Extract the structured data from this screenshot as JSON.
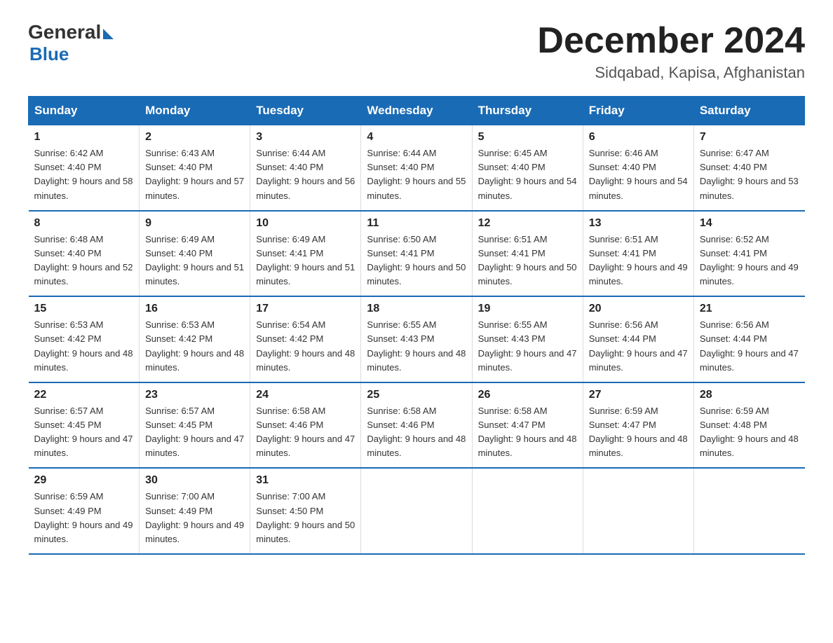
{
  "header": {
    "logo_general": "General",
    "logo_blue": "Blue",
    "month_year": "December 2024",
    "location": "Sidqabad, Kapisa, Afghanistan"
  },
  "weekdays": [
    "Sunday",
    "Monday",
    "Tuesday",
    "Wednesday",
    "Thursday",
    "Friday",
    "Saturday"
  ],
  "weeks": [
    [
      {
        "day": "1",
        "sunrise": "6:42 AM",
        "sunset": "4:40 PM",
        "daylight": "9 hours and 58 minutes."
      },
      {
        "day": "2",
        "sunrise": "6:43 AM",
        "sunset": "4:40 PM",
        "daylight": "9 hours and 57 minutes."
      },
      {
        "day": "3",
        "sunrise": "6:44 AM",
        "sunset": "4:40 PM",
        "daylight": "9 hours and 56 minutes."
      },
      {
        "day": "4",
        "sunrise": "6:44 AM",
        "sunset": "4:40 PM",
        "daylight": "9 hours and 55 minutes."
      },
      {
        "day": "5",
        "sunrise": "6:45 AM",
        "sunset": "4:40 PM",
        "daylight": "9 hours and 54 minutes."
      },
      {
        "day": "6",
        "sunrise": "6:46 AM",
        "sunset": "4:40 PM",
        "daylight": "9 hours and 54 minutes."
      },
      {
        "day": "7",
        "sunrise": "6:47 AM",
        "sunset": "4:40 PM",
        "daylight": "9 hours and 53 minutes."
      }
    ],
    [
      {
        "day": "8",
        "sunrise": "6:48 AM",
        "sunset": "4:40 PM",
        "daylight": "9 hours and 52 minutes."
      },
      {
        "day": "9",
        "sunrise": "6:49 AM",
        "sunset": "4:40 PM",
        "daylight": "9 hours and 51 minutes."
      },
      {
        "day": "10",
        "sunrise": "6:49 AM",
        "sunset": "4:41 PM",
        "daylight": "9 hours and 51 minutes."
      },
      {
        "day": "11",
        "sunrise": "6:50 AM",
        "sunset": "4:41 PM",
        "daylight": "9 hours and 50 minutes."
      },
      {
        "day": "12",
        "sunrise": "6:51 AM",
        "sunset": "4:41 PM",
        "daylight": "9 hours and 50 minutes."
      },
      {
        "day": "13",
        "sunrise": "6:51 AM",
        "sunset": "4:41 PM",
        "daylight": "9 hours and 49 minutes."
      },
      {
        "day": "14",
        "sunrise": "6:52 AM",
        "sunset": "4:41 PM",
        "daylight": "9 hours and 49 minutes."
      }
    ],
    [
      {
        "day": "15",
        "sunrise": "6:53 AM",
        "sunset": "4:42 PM",
        "daylight": "9 hours and 48 minutes."
      },
      {
        "day": "16",
        "sunrise": "6:53 AM",
        "sunset": "4:42 PM",
        "daylight": "9 hours and 48 minutes."
      },
      {
        "day": "17",
        "sunrise": "6:54 AM",
        "sunset": "4:42 PM",
        "daylight": "9 hours and 48 minutes."
      },
      {
        "day": "18",
        "sunrise": "6:55 AM",
        "sunset": "4:43 PM",
        "daylight": "9 hours and 48 minutes."
      },
      {
        "day": "19",
        "sunrise": "6:55 AM",
        "sunset": "4:43 PM",
        "daylight": "9 hours and 47 minutes."
      },
      {
        "day": "20",
        "sunrise": "6:56 AM",
        "sunset": "4:44 PM",
        "daylight": "9 hours and 47 minutes."
      },
      {
        "day": "21",
        "sunrise": "6:56 AM",
        "sunset": "4:44 PM",
        "daylight": "9 hours and 47 minutes."
      }
    ],
    [
      {
        "day": "22",
        "sunrise": "6:57 AM",
        "sunset": "4:45 PM",
        "daylight": "9 hours and 47 minutes."
      },
      {
        "day": "23",
        "sunrise": "6:57 AM",
        "sunset": "4:45 PM",
        "daylight": "9 hours and 47 minutes."
      },
      {
        "day": "24",
        "sunrise": "6:58 AM",
        "sunset": "4:46 PM",
        "daylight": "9 hours and 47 minutes."
      },
      {
        "day": "25",
        "sunrise": "6:58 AM",
        "sunset": "4:46 PM",
        "daylight": "9 hours and 48 minutes."
      },
      {
        "day": "26",
        "sunrise": "6:58 AM",
        "sunset": "4:47 PM",
        "daylight": "9 hours and 48 minutes."
      },
      {
        "day": "27",
        "sunrise": "6:59 AM",
        "sunset": "4:47 PM",
        "daylight": "9 hours and 48 minutes."
      },
      {
        "day": "28",
        "sunrise": "6:59 AM",
        "sunset": "4:48 PM",
        "daylight": "9 hours and 48 minutes."
      }
    ],
    [
      {
        "day": "29",
        "sunrise": "6:59 AM",
        "sunset": "4:49 PM",
        "daylight": "9 hours and 49 minutes."
      },
      {
        "day": "30",
        "sunrise": "7:00 AM",
        "sunset": "4:49 PM",
        "daylight": "9 hours and 49 minutes."
      },
      {
        "day": "31",
        "sunrise": "7:00 AM",
        "sunset": "4:50 PM",
        "daylight": "9 hours and 50 minutes."
      },
      null,
      null,
      null,
      null
    ]
  ]
}
